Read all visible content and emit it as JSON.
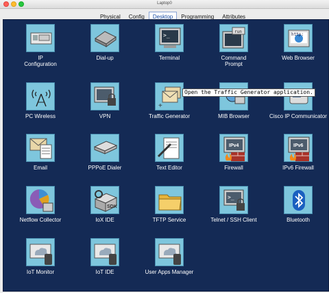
{
  "window": {
    "title": "Laptop0"
  },
  "tabs": [
    "Physical",
    "Config",
    "Desktop",
    "Programming",
    "Attributes"
  ],
  "active_tab": "Desktop",
  "apps": [
    {
      "label": "IP\nConfiguration",
      "icon": "ip-configuration-icon"
    },
    {
      "label": "Dial-up",
      "icon": "dial-up-icon"
    },
    {
      "label": "Terminal",
      "icon": "terminal-icon"
    },
    {
      "label": "Command\nPrompt",
      "icon": "command-prompt-icon"
    },
    {
      "label": "Web Browser",
      "icon": "web-browser-icon"
    },
    {
      "label": "PC Wireless",
      "icon": "pc-wireless-icon"
    },
    {
      "label": "VPN",
      "icon": "vpn-icon"
    },
    {
      "label": "Traffic Generator",
      "icon": "traffic-generator-icon"
    },
    {
      "label": "MIB Browser",
      "icon": "mib-browser-icon"
    },
    {
      "label": "Cisco IP Communicator",
      "icon": "cisco-ip-communicator-icon"
    },
    {
      "label": "Email",
      "icon": "email-icon"
    },
    {
      "label": "PPPoE Dialer",
      "icon": "pppoe-dialer-icon"
    },
    {
      "label": "Text Editor",
      "icon": "text-editor-icon"
    },
    {
      "label": "Firewall",
      "icon": "firewall-icon",
      "badge": "IPv4"
    },
    {
      "label": "IPv6 Firewall",
      "icon": "ipv6-firewall-icon",
      "badge": "IPv6"
    },
    {
      "label": "Netflow Collector",
      "icon": "netflow-collector-icon"
    },
    {
      "label": "IoX IDE",
      "icon": "iox-ide-icon",
      "badge": "SDK"
    },
    {
      "label": "TFTP Service",
      "icon": "tftp-service-icon"
    },
    {
      "label": "Telnet / SSH Client",
      "icon": "telnet-ssh-client-icon"
    },
    {
      "label": "Bluetooth",
      "icon": "bluetooth-icon"
    },
    {
      "label": "IoT Monitor",
      "icon": "iot-monitor-icon"
    },
    {
      "label": "IoT IDE",
      "icon": "iot-ide-icon"
    },
    {
      "label": "User Apps Manager",
      "icon": "user-apps-manager-icon"
    }
  ],
  "tooltip": "Open the Traffic Generator application.",
  "icon_text": {
    "terminal": ">_",
    "command": "run",
    "web": "http:",
    "telnet": ">_"
  },
  "colors": {
    "desktop": "#142a55",
    "tile": "#7ec6dd",
    "active_tab": "#1b4fa6"
  }
}
